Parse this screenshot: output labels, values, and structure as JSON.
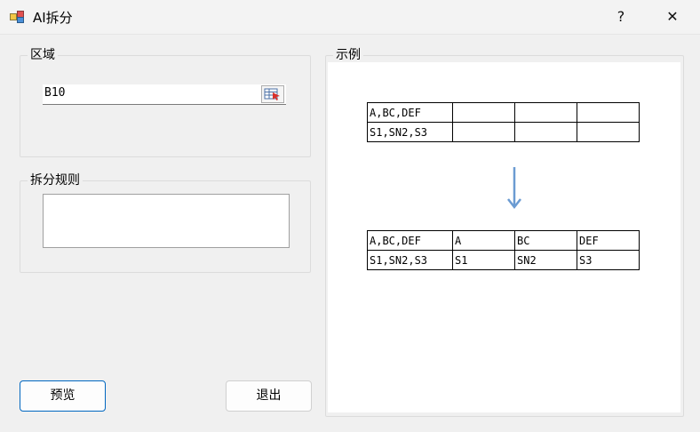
{
  "window": {
    "title": "AI拆分",
    "help_label": "?",
    "close_label": "✕"
  },
  "region_group": {
    "label": "区域",
    "input_value": "B10",
    "picker_icon": "range-select-icon"
  },
  "rules_group": {
    "label": "拆分规则",
    "input_value": ""
  },
  "example_group": {
    "label": "示例",
    "before_table": [
      [
        "A,BC,DEF",
        "",
        "",
        ""
      ],
      [
        "S1,SN2,S3",
        "",
        "",
        ""
      ]
    ],
    "after_table": [
      [
        "A,BC,DEF",
        "A",
        "BC",
        "DEF"
      ],
      [
        "S1,SN2,S3",
        "S1",
        "SN2",
        "S3"
      ]
    ],
    "arrow_icon": "arrow-down-icon",
    "arrow_color": "#6b9bd2"
  },
  "buttons": {
    "preview_label": "预览",
    "exit_label": "退出"
  },
  "colors": {
    "accent": "#0067c0",
    "background": "#f0f0f0"
  }
}
